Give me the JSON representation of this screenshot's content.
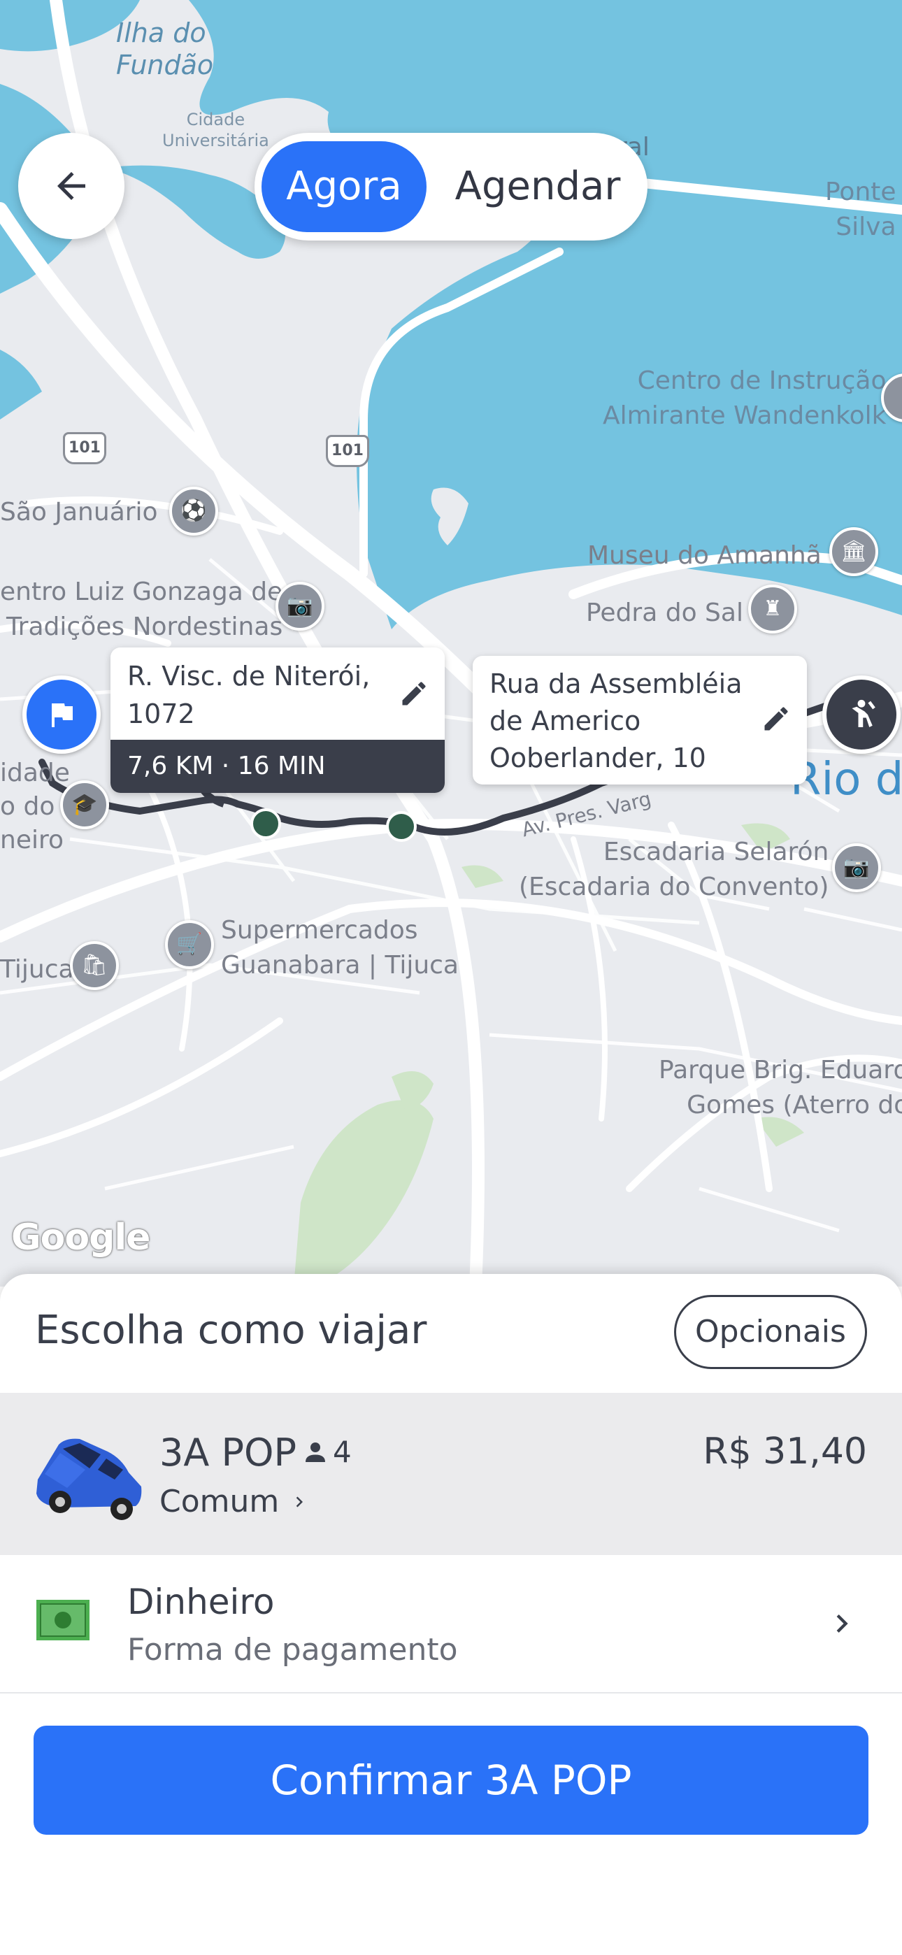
{
  "map": {
    "labels": {
      "ilha_do_fundao": "Ilha do\nFundão",
      "cidade_universitaria": "Cidade\nUniversitária",
      "ral": "ral",
      "ponte_silva": "Ponte\nSilva",
      "centro_instrucao": "Centro de Instrução\nAlmirante Wandenkolk",
      "sao_januario": "São Januário",
      "museu_amanha": "Museu do Amanhã",
      "centro_luiz_gonzaga": "entro Luiz Gonzaga de\nTradições Nordestinas",
      "pedra_do_sal": "Pedra do Sal",
      "rio_de": "Rio de",
      "av_pres_vargas": "Av. Pres. Varg",
      "cidade_do_samba": "idade\no do\nneiro",
      "escadaria_selaron": "Escadaria Selarón\n(Escadaria do Convento)",
      "tijuca": "Tijuca",
      "supermercados": "Supermercados\nGuanabara | Tijuca",
      "parque_brig": "Parque Brig. Eduard\nGomes (Aterro do"
    },
    "road_shields": [
      "101",
      "101"
    ],
    "google_logo": "Google",
    "colors": {
      "water": "#74c3e0",
      "land": "#e9ebef",
      "park": "#cfe5c8",
      "route": "#3a3e4a"
    }
  },
  "top": {
    "segment_active": "Agora",
    "segment_inactive": "Agendar"
  },
  "route": {
    "origin_address": "R. Visc. de Niterói, 1072",
    "trip_meta": "7,6 KM · 16 MIN",
    "destination_address": "Rua da Assembléia de Americo Ooberlander, 10"
  },
  "sheet": {
    "title": "Escolha como viajar",
    "optionals_button": "Opcionais",
    "ride": {
      "name": "3A POP",
      "seats": "4",
      "category": "Comum",
      "price": "R$ 31,40"
    },
    "payment": {
      "method": "Dinheiro",
      "subtitle": "Forma de pagamento"
    },
    "confirm_button": "Confirmar 3A POP"
  },
  "colors": {
    "accent": "#2a72f8",
    "text": "#3a3f4b",
    "selected_row_bg": "#ebebed"
  }
}
